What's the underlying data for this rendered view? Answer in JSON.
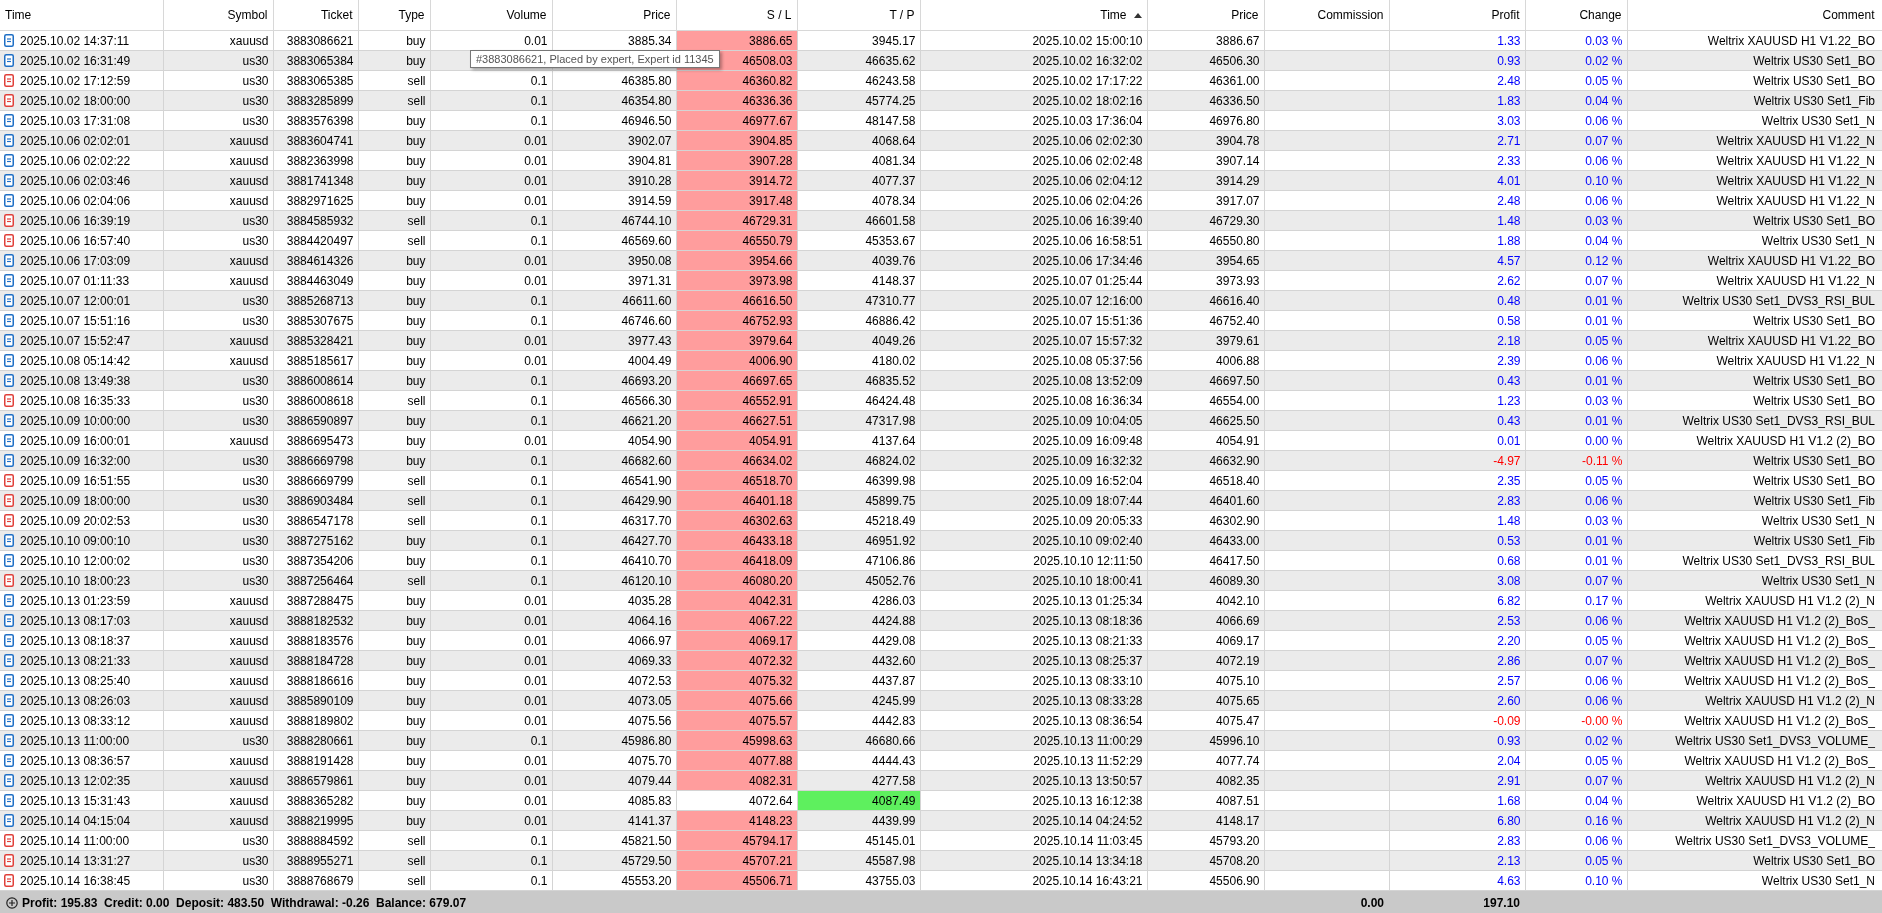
{
  "columns": [
    {
      "label": "Time",
      "sorted": false
    },
    {
      "label": "Symbol",
      "sorted": false
    },
    {
      "label": "Ticket",
      "sorted": false
    },
    {
      "label": "Type",
      "sorted": false
    },
    {
      "label": "Volume",
      "sorted": false
    },
    {
      "label": "Price",
      "sorted": false
    },
    {
      "label": "S / L",
      "sorted": false
    },
    {
      "label": "T / P",
      "sorted": false
    },
    {
      "label": "Time",
      "sorted": true
    },
    {
      "label": "Price",
      "sorted": false
    },
    {
      "label": "Commission",
      "sorted": false
    },
    {
      "label": "Profit",
      "sorted": false
    },
    {
      "label": "Change",
      "sorted": false
    },
    {
      "label": "Comment",
      "sorted": false
    }
  ],
  "rows": [
    {
      "kind": "buy",
      "time": "2025.10.02 14:37:11",
      "symbol": "xauusd",
      "ticket": "3883086621",
      "type": "buy",
      "volume": "0.01",
      "price": "3885.34",
      "sl": "3886.65",
      "tp": "3945.17",
      "close_time": "2025.10.02 15:00:10",
      "close_price": "3886.67",
      "profit": "1.33",
      "change": "0.03 %",
      "loss": false,
      "sl_hit": true,
      "tp_hit": false,
      "comment": "Weltrix XAUUSD H1 V1.22_BO"
    },
    {
      "kind": "buy",
      "time": "2025.10.02 16:31:49",
      "symbol": "us30",
      "ticket": "3883065384",
      "type": "buy",
      "sl": "46508.03",
      "tp": "46635.62",
      "close_time": "2025.10.02 16:32:02",
      "close_price": "46506.30",
      "profit": "0.93",
      "change": "0.02 %",
      "loss": false,
      "sl_hit": true,
      "tp_hit": false,
      "comment": "Weltrix US30 Set1_BO"
    },
    {
      "kind": "sell",
      "time": "2025.10.02 17:12:59",
      "symbol": "us30",
      "ticket": "3883065385",
      "type": "sell",
      "volume": "0.1",
      "price": "46385.80",
      "sl": "46360.82",
      "tp": "46243.58",
      "close_time": "2025.10.02 17:17:22",
      "close_price": "46361.00",
      "profit": "2.48",
      "change": "0.05 %",
      "loss": false,
      "sl_hit": true,
      "tp_hit": false,
      "comment": "Weltrix US30 Set1_BO"
    },
    {
      "kind": "sell",
      "time": "2025.10.02 18:00:00",
      "symbol": "us30",
      "ticket": "3883285899",
      "type": "sell",
      "volume": "0.1",
      "price": "46354.80",
      "sl": "46336.36",
      "tp": "45774.25",
      "close_time": "2025.10.02 18:02:16",
      "close_price": "46336.50",
      "profit": "1.83",
      "change": "0.04 %",
      "loss": false,
      "sl_hit": true,
      "tp_hit": false,
      "comment": "Weltrix US30 Set1_Fib"
    },
    {
      "kind": "buy",
      "time": "2025.10.03 17:31:08",
      "symbol": "us30",
      "ticket": "3883576398",
      "type": "buy",
      "volume": "0.1",
      "price": "46946.50",
      "sl": "46977.67",
      "tp": "48147.58",
      "close_time": "2025.10.03 17:36:04",
      "close_price": "46976.80",
      "profit": "3.03",
      "change": "0.06 %",
      "loss": false,
      "sl_hit": true,
      "tp_hit": false,
      "comment": "Weltrix US30 Set1_N"
    },
    {
      "kind": "buy",
      "time": "2025.10.06 02:02:01",
      "symbol": "xauusd",
      "ticket": "3883604741",
      "type": "buy",
      "volume": "0.01",
      "price": "3902.07",
      "sl": "3904.85",
      "tp": "4068.64",
      "close_time": "2025.10.06 02:02:30",
      "close_price": "3904.78",
      "profit": "2.71",
      "change": "0.07 %",
      "loss": false,
      "sl_hit": true,
      "tp_hit": false,
      "comment": "Weltrix XAUUSD H1 V1.22_N"
    },
    {
      "kind": "buy",
      "time": "2025.10.06 02:02:22",
      "symbol": "xauusd",
      "ticket": "3882363998",
      "type": "buy",
      "volume": "0.01",
      "price": "3904.81",
      "sl": "3907.28",
      "tp": "4081.34",
      "close_time": "2025.10.06 02:02:48",
      "close_price": "3907.14",
      "profit": "2.33",
      "change": "0.06 %",
      "loss": false,
      "sl_hit": true,
      "tp_hit": false,
      "comment": "Weltrix XAUUSD H1 V1.22_N"
    },
    {
      "kind": "buy",
      "time": "2025.10.06 02:03:46",
      "symbol": "xauusd",
      "ticket": "3881741348",
      "type": "buy",
      "volume": "0.01",
      "price": "3910.28",
      "sl": "3914.72",
      "tp": "4077.37",
      "close_time": "2025.10.06 02:04:12",
      "close_price": "3914.29",
      "profit": "4.01",
      "change": "0.10 %",
      "loss": false,
      "sl_hit": true,
      "tp_hit": false,
      "comment": "Weltrix XAUUSD H1 V1.22_N"
    },
    {
      "kind": "buy",
      "time": "2025.10.06 02:04:06",
      "symbol": "xauusd",
      "ticket": "3882971625",
      "type": "buy",
      "volume": "0.01",
      "price": "3914.59",
      "sl": "3917.48",
      "tp": "4078.34",
      "close_time": "2025.10.06 02:04:26",
      "close_price": "3917.07",
      "profit": "2.48",
      "change": "0.06 %",
      "loss": false,
      "sl_hit": true,
      "tp_hit": false,
      "comment": "Weltrix XAUUSD H1 V1.22_N"
    },
    {
      "kind": "sell",
      "time": "2025.10.06 16:39:19",
      "symbol": "us30",
      "ticket": "3884585932",
      "type": "sell",
      "volume": "0.1",
      "price": "46744.10",
      "sl": "46729.31",
      "tp": "46601.58",
      "close_time": "2025.10.06 16:39:40",
      "close_price": "46729.30",
      "profit": "1.48",
      "change": "0.03 %",
      "loss": false,
      "sl_hit": true,
      "tp_hit": false,
      "comment": "Weltrix US30 Set1_BO"
    },
    {
      "kind": "sell",
      "time": "2025.10.06 16:57:40",
      "symbol": "us30",
      "ticket": "3884420497",
      "type": "sell",
      "volume": "0.1",
      "price": "46569.60",
      "sl": "46550.79",
      "tp": "45353.67",
      "close_time": "2025.10.06 16:58:51",
      "close_price": "46550.80",
      "profit": "1.88",
      "change": "0.04 %",
      "loss": false,
      "sl_hit": true,
      "tp_hit": false,
      "comment": "Weltrix US30 Set1_N"
    },
    {
      "kind": "buy",
      "time": "2025.10.06 17:03:09",
      "symbol": "xauusd",
      "ticket": "3884614326",
      "type": "buy",
      "volume": "0.01",
      "price": "3950.08",
      "sl": "3954.66",
      "tp": "4039.76",
      "close_time": "2025.10.06 17:34:46",
      "close_price": "3954.65",
      "profit": "4.57",
      "change": "0.12 %",
      "loss": false,
      "sl_hit": true,
      "tp_hit": false,
      "comment": "Weltrix XAUUSD H1 V1.22_BO"
    },
    {
      "kind": "buy",
      "time": "2025.10.07 01:11:33",
      "symbol": "xauusd",
      "ticket": "3884463049",
      "type": "buy",
      "volume": "0.01",
      "price": "3971.31",
      "sl": "3973.98",
      "tp": "4148.37",
      "close_time": "2025.10.07 01:25:44",
      "close_price": "3973.93",
      "profit": "2.62",
      "change": "0.07 %",
      "loss": false,
      "sl_hit": true,
      "tp_hit": false,
      "comment": "Weltrix XAUUSD H1 V1.22_N"
    },
    {
      "kind": "buy",
      "time": "2025.10.07 12:00:01",
      "symbol": "us30",
      "ticket": "3885268713",
      "type": "buy",
      "volume": "0.1",
      "price": "46611.60",
      "sl": "46616.50",
      "tp": "47310.77",
      "close_time": "2025.10.07 12:16:00",
      "close_price": "46616.40",
      "profit": "0.48",
      "change": "0.01 %",
      "loss": false,
      "sl_hit": true,
      "tp_hit": false,
      "comment": "Weltrix US30 Set1_DVS3_RSI_BUL"
    },
    {
      "kind": "buy",
      "time": "2025.10.07 15:51:16",
      "symbol": "us30",
      "ticket": "3885307675",
      "type": "buy",
      "volume": "0.1",
      "price": "46746.60",
      "sl": "46752.93",
      "tp": "46886.42",
      "close_time": "2025.10.07 15:51:36",
      "close_price": "46752.40",
      "profit": "0.58",
      "change": "0.01 %",
      "loss": false,
      "sl_hit": true,
      "tp_hit": false,
      "comment": "Weltrix US30 Set1_BO"
    },
    {
      "kind": "buy",
      "time": "2025.10.07 15:52:47",
      "symbol": "xauusd",
      "ticket": "3885328421",
      "type": "buy",
      "volume": "0.01",
      "price": "3977.43",
      "sl": "3979.64",
      "tp": "4049.26",
      "close_time": "2025.10.07 15:57:32",
      "close_price": "3979.61",
      "profit": "2.18",
      "change": "0.05 %",
      "loss": false,
      "sl_hit": true,
      "tp_hit": false,
      "comment": "Weltrix XAUUSD H1 V1.22_BO"
    },
    {
      "kind": "buy",
      "time": "2025.10.08 05:14:42",
      "symbol": "xauusd",
      "ticket": "3885185617",
      "type": "buy",
      "volume": "0.01",
      "price": "4004.49",
      "sl": "4006.90",
      "tp": "4180.02",
      "close_time": "2025.10.08 05:37:56",
      "close_price": "4006.88",
      "profit": "2.39",
      "change": "0.06 %",
      "loss": false,
      "sl_hit": true,
      "tp_hit": false,
      "comment": "Weltrix XAUUSD H1 V1.22_N"
    },
    {
      "kind": "buy",
      "time": "2025.10.08 13:49:38",
      "symbol": "us30",
      "ticket": "3886008614",
      "type": "buy",
      "volume": "0.1",
      "price": "46693.20",
      "sl": "46697.65",
      "tp": "46835.52",
      "close_time": "2025.10.08 13:52:09",
      "close_price": "46697.50",
      "profit": "0.43",
      "change": "0.01 %",
      "loss": false,
      "sl_hit": true,
      "tp_hit": false,
      "comment": "Weltrix US30 Set1_BO"
    },
    {
      "kind": "sell",
      "time": "2025.10.08 16:35:33",
      "symbol": "us30",
      "ticket": "3886008618",
      "type": "sell",
      "volume": "0.1",
      "price": "46566.30",
      "sl": "46552.91",
      "tp": "46424.48",
      "close_time": "2025.10.08 16:36:34",
      "close_price": "46554.00",
      "profit": "1.23",
      "change": "0.03 %",
      "loss": false,
      "sl_hit": true,
      "tp_hit": false,
      "comment": "Weltrix US30 Set1_BO"
    },
    {
      "kind": "buy",
      "time": "2025.10.09 10:00:00",
      "symbol": "us30",
      "ticket": "3886590897",
      "type": "buy",
      "volume": "0.1",
      "price": "46621.20",
      "sl": "46627.51",
      "tp": "47317.98",
      "close_time": "2025.10.09 10:04:05",
      "close_price": "46625.50",
      "profit": "0.43",
      "change": "0.01 %",
      "loss": false,
      "sl_hit": true,
      "tp_hit": false,
      "comment": "Weltrix US30 Set1_DVS3_RSI_BUL"
    },
    {
      "kind": "buy",
      "time": "2025.10.09 16:00:01",
      "symbol": "xauusd",
      "ticket": "3886695473",
      "type": "buy",
      "volume": "0.01",
      "price": "4054.90",
      "sl": "4054.91",
      "tp": "4137.64",
      "close_time": "2025.10.09 16:09:48",
      "close_price": "4054.91",
      "profit": "0.01",
      "change": "0.00 %",
      "loss": false,
      "sl_hit": true,
      "tp_hit": false,
      "comment": "Weltrix XAUUSD H1 V1.2 (2)_BO"
    },
    {
      "kind": "buy",
      "time": "2025.10.09 16:32:00",
      "symbol": "us30",
      "ticket": "3886669798",
      "type": "buy",
      "volume": "0.1",
      "price": "46682.60",
      "sl": "46634.02",
      "tp": "46824.02",
      "close_time": "2025.10.09 16:32:32",
      "close_price": "46632.90",
      "profit": "-4.97",
      "change": "-0.11 %",
      "loss": true,
      "sl_hit": true,
      "tp_hit": false,
      "comment": "Weltrix US30 Set1_BO"
    },
    {
      "kind": "sell",
      "time": "2025.10.09 16:51:55",
      "symbol": "us30",
      "ticket": "3886669799",
      "type": "sell",
      "volume": "0.1",
      "price": "46541.90",
      "sl": "46518.70",
      "tp": "46399.98",
      "close_time": "2025.10.09 16:52:04",
      "close_price": "46518.40",
      "profit": "2.35",
      "change": "0.05 %",
      "loss": false,
      "sl_hit": true,
      "tp_hit": false,
      "comment": "Weltrix US30 Set1_BO"
    },
    {
      "kind": "sell",
      "time": "2025.10.09 18:00:00",
      "symbol": "us30",
      "ticket": "3886903484",
      "type": "sell",
      "volume": "0.1",
      "price": "46429.90",
      "sl": "46401.18",
      "tp": "45899.75",
      "close_time": "2025.10.09 18:07:44",
      "close_price": "46401.60",
      "profit": "2.83",
      "change": "0.06 %",
      "loss": false,
      "sl_hit": true,
      "tp_hit": false,
      "comment": "Weltrix US30 Set1_Fib"
    },
    {
      "kind": "sell",
      "time": "2025.10.09 20:02:53",
      "symbol": "us30",
      "ticket": "3886547178",
      "type": "sell",
      "volume": "0.1",
      "price": "46317.70",
      "sl": "46302.63",
      "tp": "45218.49",
      "close_time": "2025.10.09 20:05:33",
      "close_price": "46302.90",
      "profit": "1.48",
      "change": "0.03 %",
      "loss": false,
      "sl_hit": true,
      "tp_hit": false,
      "comment": "Weltrix US30 Set1_N"
    },
    {
      "kind": "buy",
      "time": "2025.10.10 09:00:10",
      "symbol": "us30",
      "ticket": "3887275162",
      "type": "buy",
      "volume": "0.1",
      "price": "46427.70",
      "sl": "46433.18",
      "tp": "46951.92",
      "close_time": "2025.10.10 09:02:40",
      "close_price": "46433.00",
      "profit": "0.53",
      "change": "0.01 %",
      "loss": false,
      "sl_hit": true,
      "tp_hit": false,
      "comment": "Weltrix US30 Set1_Fib"
    },
    {
      "kind": "buy",
      "time": "2025.10.10 12:00:02",
      "symbol": "us30",
      "ticket": "3887354206",
      "type": "buy",
      "volume": "0.1",
      "price": "46410.70",
      "sl": "46418.09",
      "tp": "47106.86",
      "close_time": "2025.10.10 12:11:50",
      "close_price": "46417.50",
      "profit": "0.68",
      "change": "0.01 %",
      "loss": false,
      "sl_hit": true,
      "tp_hit": false,
      "comment": "Weltrix US30 Set1_DVS3_RSI_BUL"
    },
    {
      "kind": "sell",
      "time": "2025.10.10 18:00:23",
      "symbol": "us30",
      "ticket": "3887256464",
      "type": "sell",
      "volume": "0.1",
      "price": "46120.10",
      "sl": "46080.20",
      "tp": "45052.76",
      "close_time": "2025.10.10 18:00:41",
      "close_price": "46089.30",
      "profit": "3.08",
      "change": "0.07 %",
      "loss": false,
      "sl_hit": true,
      "tp_hit": false,
      "comment": "Weltrix US30 Set1_N"
    },
    {
      "kind": "buy",
      "time": "2025.10.13 01:23:59",
      "symbol": "xauusd",
      "ticket": "3887288475",
      "type": "buy",
      "volume": "0.01",
      "price": "4035.28",
      "sl": "4042.31",
      "tp": "4286.03",
      "close_time": "2025.10.13 01:25:34",
      "close_price": "4042.10",
      "profit": "6.82",
      "change": "0.17 %",
      "loss": false,
      "sl_hit": true,
      "tp_hit": false,
      "comment": "Weltrix XAUUSD H1 V1.2 (2)_N"
    },
    {
      "kind": "buy",
      "time": "2025.10.13 08:17:03",
      "symbol": "xauusd",
      "ticket": "3888182532",
      "type": "buy",
      "volume": "0.01",
      "price": "4064.16",
      "sl": "4067.22",
      "tp": "4424.88",
      "close_time": "2025.10.13 08:18:36",
      "close_price": "4066.69",
      "profit": "2.53",
      "change": "0.06 %",
      "loss": false,
      "sl_hit": true,
      "tp_hit": false,
      "comment": "Weltrix XAUUSD H1 V1.2 (2)_BoS_"
    },
    {
      "kind": "buy",
      "time": "2025.10.13 08:18:37",
      "symbol": "xauusd",
      "ticket": "3888183576",
      "type": "buy",
      "volume": "0.01",
      "price": "4066.97",
      "sl": "4069.17",
      "tp": "4429.08",
      "close_time": "2025.10.13 08:21:33",
      "close_price": "4069.17",
      "profit": "2.20",
      "change": "0.05 %",
      "loss": false,
      "sl_hit": true,
      "tp_hit": false,
      "comment": "Weltrix XAUUSD H1 V1.2 (2)_BoS_"
    },
    {
      "kind": "buy",
      "time": "2025.10.13 08:21:33",
      "symbol": "xauusd",
      "ticket": "3888184728",
      "type": "buy",
      "volume": "0.01",
      "price": "4069.33",
      "sl": "4072.32",
      "tp": "4432.60",
      "close_time": "2025.10.13 08:25:37",
      "close_price": "4072.19",
      "profit": "2.86",
      "change": "0.07 %",
      "loss": false,
      "sl_hit": true,
      "tp_hit": false,
      "comment": "Weltrix XAUUSD H1 V1.2 (2)_BoS_"
    },
    {
      "kind": "buy",
      "time": "2025.10.13 08:25:40",
      "symbol": "xauusd",
      "ticket": "3888186616",
      "type": "buy",
      "volume": "0.01",
      "price": "4072.53",
      "sl": "4075.32",
      "tp": "4437.87",
      "close_time": "2025.10.13 08:33:10",
      "close_price": "4075.10",
      "profit": "2.57",
      "change": "0.06 %",
      "loss": false,
      "sl_hit": true,
      "tp_hit": false,
      "comment": "Weltrix XAUUSD H1 V1.2 (2)_BoS_"
    },
    {
      "kind": "buy",
      "time": "2025.10.13 08:26:03",
      "symbol": "xauusd",
      "ticket": "3885890109",
      "type": "buy",
      "volume": "0.01",
      "price": "4073.05",
      "sl": "4075.66",
      "tp": "4245.99",
      "close_time": "2025.10.13 08:33:28",
      "close_price": "4075.65",
      "profit": "2.60",
      "change": "0.06 %",
      "loss": false,
      "sl_hit": true,
      "tp_hit": false,
      "comment": "Weltrix XAUUSD H1 V1.2 (2)_N"
    },
    {
      "kind": "buy",
      "time": "2025.10.13 08:33:12",
      "symbol": "xauusd",
      "ticket": "3888189802",
      "type": "buy",
      "volume": "0.01",
      "price": "4075.56",
      "sl": "4075.57",
      "tp": "4442.83",
      "close_time": "2025.10.13 08:36:54",
      "close_price": "4075.47",
      "profit": "-0.09",
      "change": "-0.00 %",
      "loss": true,
      "sl_hit": true,
      "tp_hit": false,
      "comment": "Weltrix XAUUSD H1 V1.2 (2)_BoS_"
    },
    {
      "kind": "buy",
      "time": "2025.10.13 11:00:00",
      "symbol": "us30",
      "ticket": "3888280661",
      "type": "buy",
      "volume": "0.1",
      "price": "45986.80",
      "sl": "45998.63",
      "tp": "46680.66",
      "close_time": "2025.10.13 11:00:29",
      "close_price": "45996.10",
      "profit": "0.93",
      "change": "0.02 %",
      "loss": false,
      "sl_hit": true,
      "tp_hit": false,
      "comment": "Weltrix US30 Set1_DVS3_VOLUME_"
    },
    {
      "kind": "buy",
      "time": "2025.10.13 08:36:57",
      "symbol": "xauusd",
      "ticket": "3888191428",
      "type": "buy",
      "volume": "0.01",
      "price": "4075.70",
      "sl": "4077.88",
      "tp": "4444.43",
      "close_time": "2025.10.13 11:52:29",
      "close_price": "4077.74",
      "profit": "2.04",
      "change": "0.05 %",
      "loss": false,
      "sl_hit": true,
      "tp_hit": false,
      "comment": "Weltrix XAUUSD H1 V1.2 (2)_BoS_"
    },
    {
      "kind": "buy",
      "time": "2025.10.13 12:02:35",
      "symbol": "xauusd",
      "ticket": "3886579861",
      "type": "buy",
      "volume": "0.01",
      "price": "4079.44",
      "sl": "4082.31",
      "tp": "4277.58",
      "close_time": "2025.10.13 13:50:57",
      "close_price": "4082.35",
      "profit": "2.91",
      "change": "0.07 %",
      "loss": false,
      "sl_hit": true,
      "tp_hit": false,
      "comment": "Weltrix XAUUSD H1 V1.2 (2)_N"
    },
    {
      "kind": "buy",
      "time": "2025.10.13 15:31:43",
      "symbol": "xauusd",
      "ticket": "3888365282",
      "type": "buy",
      "volume": "0.01",
      "price": "4085.83",
      "sl": "4072.64",
      "tp": "4087.49",
      "close_time": "2025.10.13 16:12:38",
      "close_price": "4087.51",
      "profit": "1.68",
      "change": "0.04 %",
      "loss": false,
      "sl_hit": false,
      "tp_hit": true,
      "comment": "Weltrix XAUUSD H1 V1.2 (2)_BO"
    },
    {
      "kind": "buy",
      "time": "2025.10.14 04:15:04",
      "symbol": "xauusd",
      "ticket": "3888219995",
      "type": "buy",
      "volume": "0.01",
      "price": "4141.37",
      "sl": "4148.23",
      "tp": "4439.99",
      "close_time": "2025.10.14 04:24:52",
      "close_price": "4148.17",
      "profit": "6.80",
      "change": "0.16 %",
      "loss": false,
      "sl_hit": true,
      "tp_hit": false,
      "comment": "Weltrix XAUUSD H1 V1.2 (2)_N"
    },
    {
      "kind": "sell",
      "time": "2025.10.14 11:00:00",
      "symbol": "us30",
      "ticket": "3888884592",
      "type": "sell",
      "volume": "0.1",
      "price": "45821.50",
      "sl": "45794.17",
      "tp": "45145.01",
      "close_time": "2025.10.14 11:03:45",
      "close_price": "45793.20",
      "profit": "2.83",
      "change": "0.06 %",
      "loss": false,
      "sl_hit": true,
      "tp_hit": false,
      "comment": "Weltrix US30 Set1_DVS3_VOLUME_"
    },
    {
      "kind": "sell",
      "time": "2025.10.14 13:31:27",
      "symbol": "us30",
      "ticket": "3888955271",
      "type": "sell",
      "volume": "0.1",
      "price": "45729.50",
      "sl": "45707.21",
      "tp": "45587.98",
      "close_time": "2025.10.14 13:34:18",
      "close_price": "45708.20",
      "profit": "2.13",
      "change": "0.05 %",
      "loss": false,
      "sl_hit": true,
      "tp_hit": false,
      "comment": "Weltrix US30 Set1_BO"
    },
    {
      "kind": "sell",
      "time": "2025.10.14 16:38:45",
      "symbol": "us30",
      "ticket": "3888768679",
      "type": "sell",
      "volume": "0.1",
      "price": "45553.20",
      "sl": "45506.71",
      "tp": "43755.03",
      "close_time": "2025.10.14 16:43:21",
      "close_price": "45506.90",
      "profit": "4.63",
      "change": "0.10 %",
      "loss": false,
      "sl_hit": true,
      "tp_hit": false,
      "comment": "Weltrix US30 Set1_N"
    }
  ],
  "tooltip": "#3883086621, Placed by expert, Expert id 11345",
  "summary": {
    "text": "Profit: 195.83  Credit: 0.00  Deposit: 483.50  Withdrawal: -0.26  Balance: 679.07",
    "commission": "0.00",
    "profit": "197.10"
  }
}
